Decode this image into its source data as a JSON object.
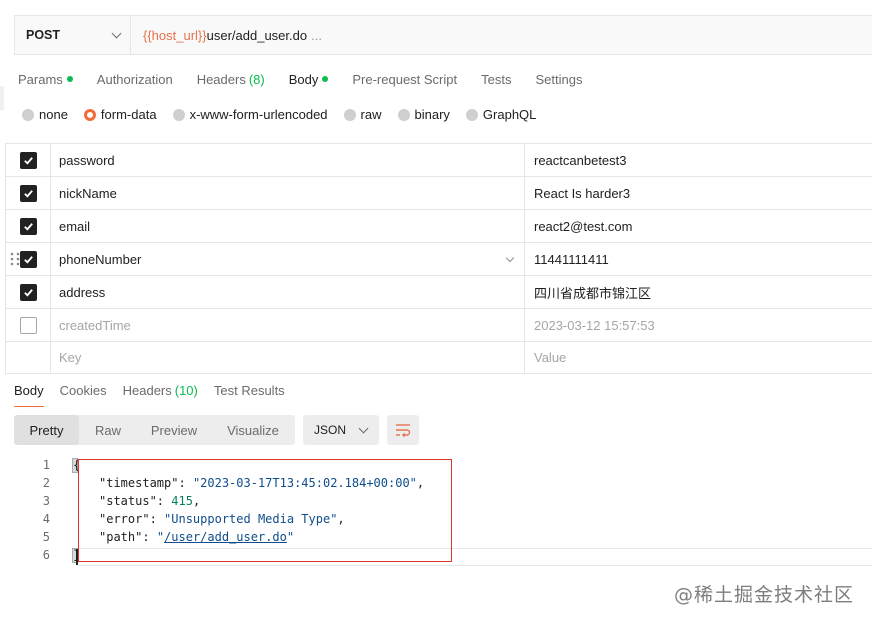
{
  "request": {
    "method": "POST",
    "url_var": "{{host_url}}",
    "url_path": "user/add_user.do",
    "url_more": "..."
  },
  "request_tabs": [
    {
      "label": "Params",
      "dot": true
    },
    {
      "label": "Authorization"
    },
    {
      "label": "Headers",
      "count": "(8)"
    },
    {
      "label": "Body",
      "dot": true,
      "active": true
    },
    {
      "label": "Pre-request Script"
    },
    {
      "label": "Tests"
    },
    {
      "label": "Settings"
    }
  ],
  "body_types": [
    "none",
    "form-data",
    "x-www-form-urlencoded",
    "raw",
    "binary",
    "GraphQL"
  ],
  "body_type_selected": "form-data",
  "form_rows": [
    {
      "key": "password",
      "value": "reactcanbetest3",
      "checked": true
    },
    {
      "key": "nickName",
      "value": "React Is harder3",
      "checked": true
    },
    {
      "key": "email",
      "value": "react2@test.com",
      "checked": true
    },
    {
      "key": "phoneNumber",
      "value": "11441111411",
      "checked": true
    },
    {
      "key": "address",
      "value": "四川省成都市锦江区",
      "checked": true
    },
    {
      "key": "createdTime",
      "value": "2023-03-12 15:57:53",
      "checked": false
    }
  ],
  "form_placeholder": {
    "key": "Key",
    "value": "Value"
  },
  "response_tabs": [
    {
      "label": "Body",
      "active": true
    },
    {
      "label": "Cookies"
    },
    {
      "label": "Headers",
      "count": "(10)"
    },
    {
      "label": "Test Results"
    }
  ],
  "view_modes": [
    "Pretty",
    "Raw",
    "Preview",
    "Visualize"
  ],
  "view_selected": "Pretty",
  "format": "JSON",
  "response": {
    "line_numbers": [
      "1",
      "2",
      "3",
      "4",
      "5",
      "6"
    ],
    "open_brace": "{",
    "close_brace": "}",
    "timestamp_key": "\"timestamp\"",
    "timestamp_val": "\"2023-03-17T13:45:02.184+00:00\"",
    "status_key": "\"status\"",
    "status_val": "415",
    "error_key": "\"error\"",
    "error_val": "\"Unsupported Media Type\"",
    "path_key": "\"path\"",
    "path_val": "/user/add_user.do"
  },
  "watermark": "@稀土掘金技术社区",
  "colors": {
    "accent": "#f26b3a",
    "green": "#0cbb52",
    "variable": "#e5734e",
    "highlight_box": "#e0342f"
  }
}
